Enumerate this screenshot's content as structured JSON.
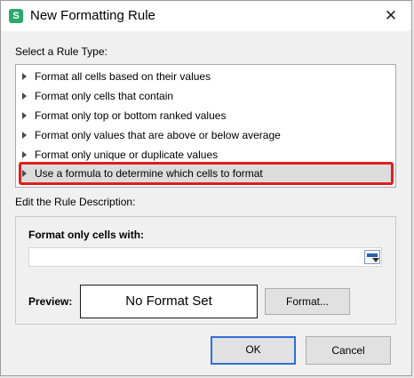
{
  "window": {
    "title": "New Formatting Rule",
    "close_glyph": "✕",
    "app_icon_letter": "S"
  },
  "rule_type": {
    "label": "Select a Rule Type:",
    "items": [
      {
        "label": "Format all cells based on their values"
      },
      {
        "label": "Format only cells that contain"
      },
      {
        "label": "Format only top or bottom ranked values"
      },
      {
        "label": "Format only values that are above or below average"
      },
      {
        "label": "Format only unique or duplicate values"
      },
      {
        "label": "Use a formula to determine which cells to format",
        "selected": true
      }
    ]
  },
  "description": {
    "label": "Edit the Rule Description:",
    "format_only_label": "Format only cells with:",
    "formula_value": "",
    "preview_label": "Preview:",
    "preview_text": "No Format Set",
    "format_button": "Format..."
  },
  "footer": {
    "ok_label": "OK",
    "cancel_label": "Cancel"
  },
  "colors": {
    "highlight_outline": "#e01e1e",
    "primary_button_border": "#2d6fd6"
  }
}
